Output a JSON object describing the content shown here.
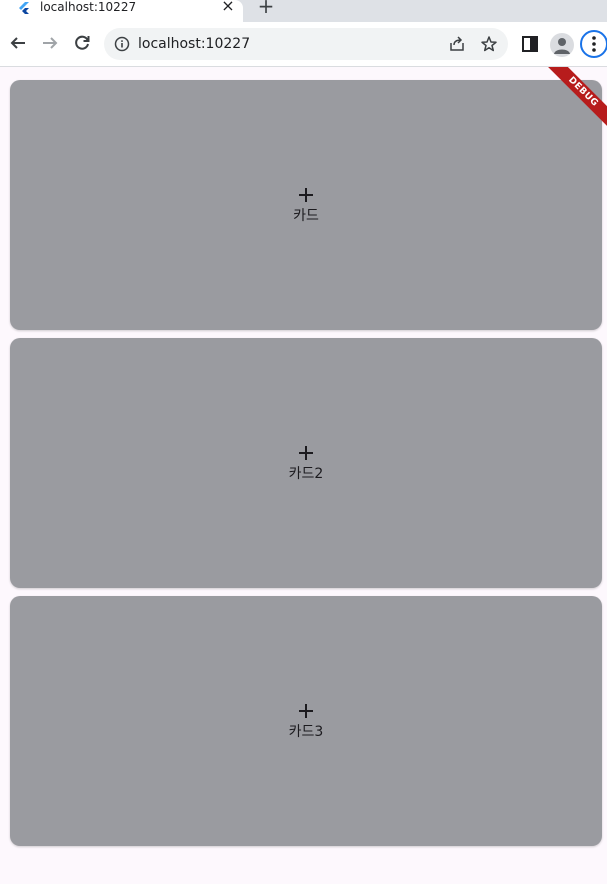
{
  "browser": {
    "tab_title": "localhost:10227",
    "tab_close": "×",
    "new_tab": "+",
    "url": "localhost:10227"
  },
  "app": {
    "debug_banner": "DEBUG",
    "cards": [
      {
        "label": "카드",
        "icon": "add-icon"
      },
      {
        "label": "카드2",
        "icon": "add-icon"
      },
      {
        "label": "카드3",
        "icon": "add-icon"
      }
    ],
    "colors": {
      "card_bg": "#9a9ba0",
      "page_bg": "#fdf8fd",
      "debug_banner": "#b71c1c"
    }
  }
}
